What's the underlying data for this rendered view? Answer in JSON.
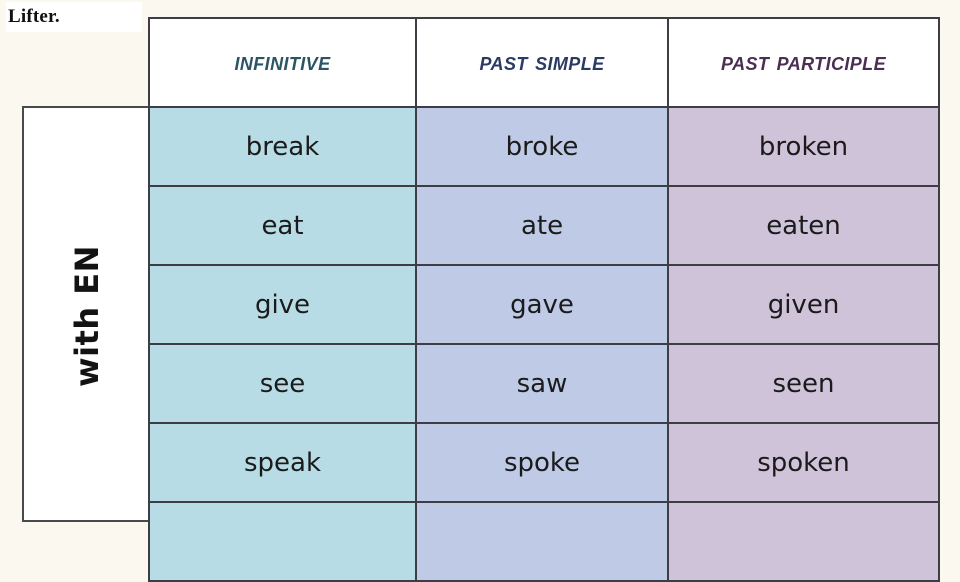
{
  "caption": {
    "text": "Lifter."
  },
  "table": {
    "group_label": "with EN",
    "headers": [
      {
        "label": "Infinitive",
        "color": "#2b5563"
      },
      {
        "label": "Past Simple",
        "color": "#2b3a63"
      },
      {
        "label": "Past Participle",
        "color": "#4a2f53"
      }
    ],
    "column_colors": {
      "infinitive": "#b7dce6",
      "past_simple": "#bfcae6",
      "past_participle": "#cfc3da"
    },
    "rows": [
      {
        "infinitive": "break",
        "past_simple": "broke",
        "past_participle": "broken"
      },
      {
        "infinitive": "eat",
        "past_simple": "ate",
        "past_participle": "eaten"
      },
      {
        "infinitive": "give",
        "past_simple": "gave",
        "past_participle": "given"
      },
      {
        "infinitive": "see",
        "past_simple": "saw",
        "past_participle": "seen"
      },
      {
        "infinitive": "speak",
        "past_simple": "spoke",
        "past_participle": "spoken"
      },
      {
        "infinitive": "",
        "past_simple": "",
        "past_participle": ""
      }
    ]
  },
  "background_color": "#fbf8f0"
}
